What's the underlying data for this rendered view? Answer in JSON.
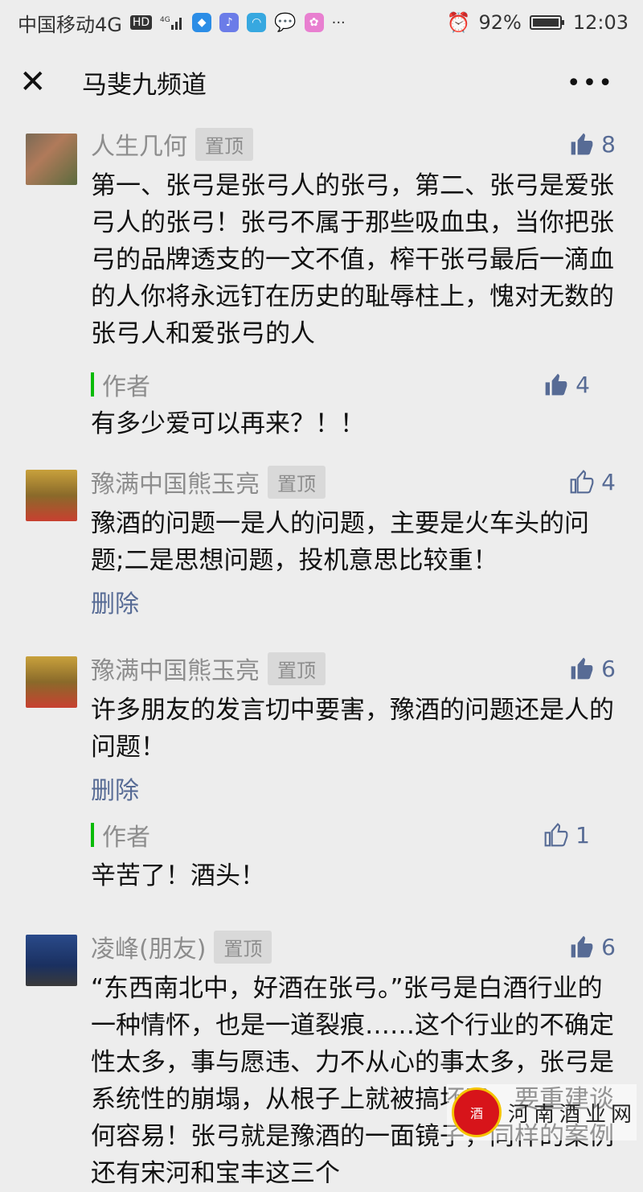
{
  "status_bar": {
    "carrier": "中国移动4G",
    "hd": "HD",
    "signal": "4G",
    "battery": "92%",
    "time": "12:03"
  },
  "nav": {
    "title": "马斐九频道",
    "close_icon": "close-icon",
    "more_icon": "more-icon"
  },
  "colors": {
    "link": "#576b95",
    "author_bar": "#09bb07",
    "pin_bg": "#d9d9d9"
  },
  "comments": [
    {
      "nickname": "人生几何",
      "pin": "置顶",
      "likes": "8",
      "liked": true,
      "text": "第一、张弓是张弓人的张弓，第二、张弓是爱张弓人的张弓！张弓不属于那些吸血虫，当你把张弓的品牌透支的一文不值，榨干张弓最后一滴血的人你将永远钉在历史的耻辱柱上，愧对无数的张弓人和爱张弓的人",
      "reply": {
        "author": "作者",
        "likes": "4",
        "liked": true,
        "text": "有多少爱可以再来？！！"
      }
    },
    {
      "nickname": "豫满中国熊玉亮",
      "pin": "置顶",
      "likes": "4",
      "liked": false,
      "text": "豫酒的问题一是人的问题，主要是火车头的问题;二是思想问题，投机意思比较重！",
      "delete": "删除"
    },
    {
      "nickname": "豫满中国熊玉亮",
      "pin": "置顶",
      "likes": "6",
      "liked": true,
      "text": "许多朋友的发言切中要害，豫酒的问题还是人的问题！",
      "delete": "删除",
      "reply": {
        "author": "作者",
        "likes": "1",
        "liked": false,
        "text": "辛苦了！酒头！"
      }
    },
    {
      "nickname": "凌峰(朋友)",
      "pin": "置顶",
      "likes": "6",
      "liked": true,
      "text": "“东西南北中，好酒在张弓。”张弓是白酒行业的一种情怀，也是一道裂痕……这个行业的不确定性太多，事与愿违、力不从心的事太多，张弓是系统性的崩塌，从根子上就被搞坏了，要重建谈何容易！张弓就是豫酒的一面镜子，同样的案例还有宋河和宝丰这三个"
    }
  ],
  "watermark": {
    "text": "河南酒业网"
  }
}
